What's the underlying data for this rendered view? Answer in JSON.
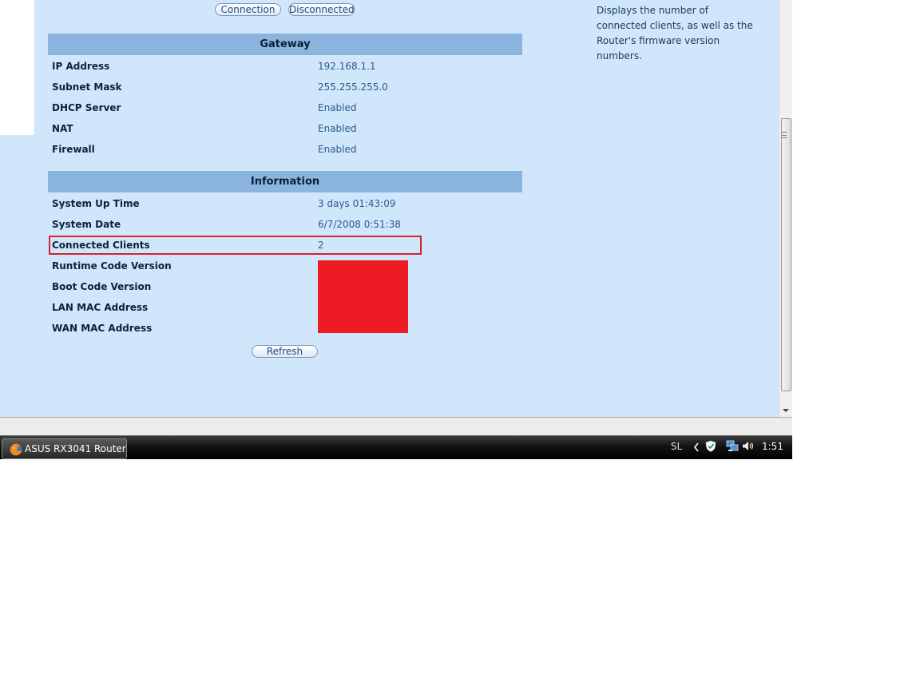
{
  "buttons": {
    "connection": "Connection",
    "disconnected": "Disconnected",
    "refresh": "Refresh"
  },
  "gateway": {
    "title": "Gateway",
    "rows": [
      {
        "label": "IP Address",
        "value": "192.168.1.1"
      },
      {
        "label": "Subnet Mask",
        "value": "255.255.255.0"
      },
      {
        "label": "DHCP Server",
        "value": "Enabled"
      },
      {
        "label": "NAT",
        "value": "Enabled"
      },
      {
        "label": "Firewall",
        "value": "Enabled"
      }
    ]
  },
  "information": {
    "title": "Information",
    "rows": [
      {
        "label": "System Up Time",
        "value": "3 days 01:43:09"
      },
      {
        "label": "System Date",
        "value": "6/7/2008 0:51:38"
      },
      {
        "label": "Connected Clients",
        "value": "2"
      },
      {
        "label": "Runtime Code Version",
        "value": ""
      },
      {
        "label": "Boot Code Version",
        "value": ""
      },
      {
        "label": "LAN MAC Address",
        "value": ""
      },
      {
        "label": "WAN MAC Address",
        "value": ""
      }
    ]
  },
  "help": {
    "text": "Displays the number of connected clients, as well as the Router's firmware version numbers."
  },
  "taskbar": {
    "task_label": "ASUS RX3041 Router...",
    "language": "SL",
    "clock": "1:51"
  },
  "colors": {
    "page_bg": "#d0e6fb",
    "header_bg": "#8bb5df",
    "highlight": "#d9212b",
    "redaction": "#ed1c24"
  },
  "icons": [
    "firefox-icon",
    "tray-chevron-icon",
    "security-shield-icon",
    "network-icon",
    "volume-icon"
  ]
}
